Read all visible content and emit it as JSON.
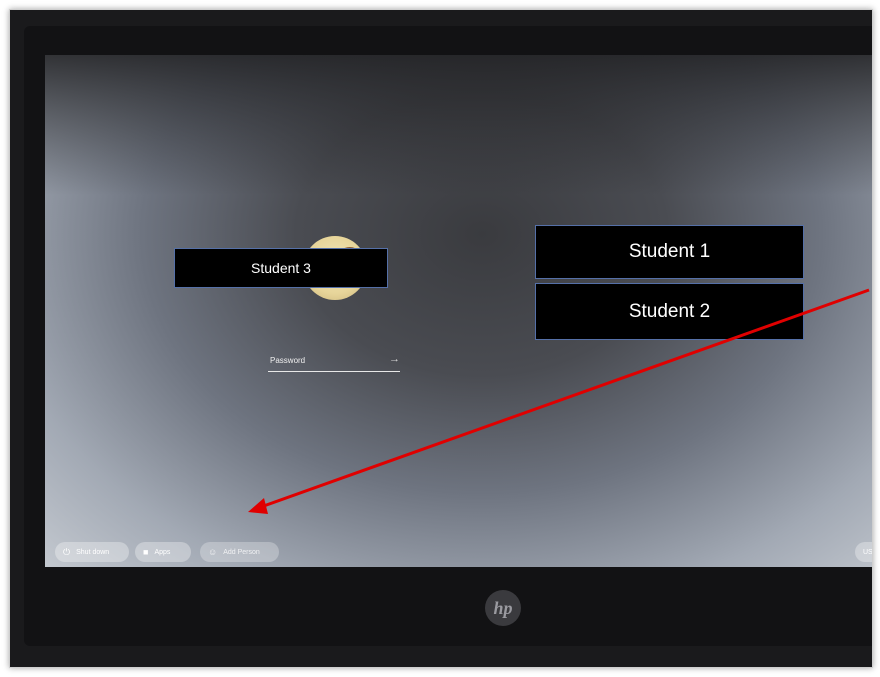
{
  "login": {
    "selected_user": "Student 3",
    "password_placeholder": "Password",
    "submit_glyph": "→",
    "other_users": [
      "Student 1",
      "Student 2"
    ]
  },
  "shelf": {
    "shutdown_label": "Shut down",
    "apps_label": "Apps",
    "add_person_label": "Add Person",
    "keyboard_layout": "US"
  },
  "device": {
    "brand_logo": "hp"
  },
  "annotation": {
    "arrow_color": "#e00000"
  }
}
